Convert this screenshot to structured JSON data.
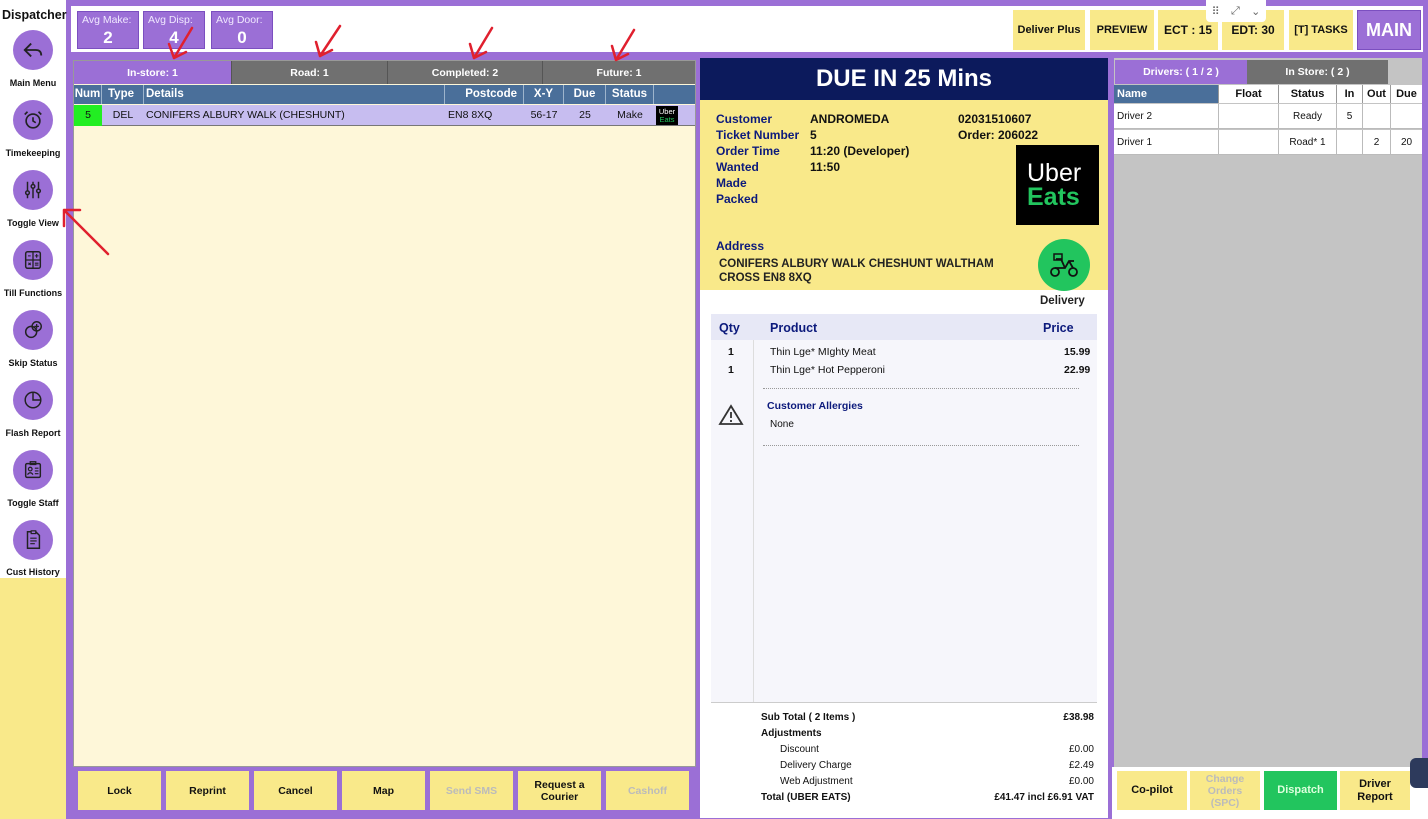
{
  "sidebar": {
    "title": "Dispatcher",
    "items": [
      {
        "label": "Main Menu",
        "icon": "back-arrow-icon"
      },
      {
        "label": "Timekeeping",
        "icon": "alarm-clock-icon"
      },
      {
        "label": "Toggle View",
        "icon": "sliders-icon"
      },
      {
        "label": "Till Functions",
        "icon": "calculator-icon"
      },
      {
        "label": "Skip Status",
        "icon": "skip-icon"
      },
      {
        "label": "Flash Report",
        "icon": "pie-chart-icon"
      },
      {
        "label": "Toggle Staff",
        "icon": "staff-card-icon"
      },
      {
        "label": "Cust History",
        "icon": "document-icon"
      }
    ]
  },
  "topbar": {
    "avg_make_label": "Avg Make:",
    "avg_make_value": "2",
    "avg_disp_label": "Avg Disp:",
    "avg_disp_value": "4",
    "avg_door_label": "Avg Door:",
    "avg_door_value": "0",
    "deliver_plus": "Deliver Plus",
    "preview": "PREVIEW",
    "ect": "ECT : 15",
    "edt": "EDT: 30",
    "tasks": "[T] TASKS",
    "main": "MAIN"
  },
  "order_tabs": [
    "In-store: 1",
    "Road: 1",
    "Completed: 2",
    "Future: 1"
  ],
  "order_columns": {
    "num": "Num",
    "type": "Type",
    "details": "Details",
    "postcode": "Postcode",
    "xy": "X-Y",
    "due": "Due",
    "status": "Status"
  },
  "orders": [
    {
      "num": "5",
      "type": "DEL",
      "details": "CONIFERS  ALBURY WALK (CHESHUNT)",
      "postcode": "EN8 8XQ",
      "xy": "56-17",
      "due": "25",
      "status": "Make",
      "source_top": "Uber",
      "source_bottom": "Eats"
    }
  ],
  "bottom_buttons": {
    "lock": "Lock",
    "reprint": "Reprint",
    "cancel": "Cancel",
    "map": "Map",
    "send_sms": "Send SMS",
    "courier_1": "Request a",
    "courier_2": "Courier",
    "cashoff": "Cashoff"
  },
  "ticket": {
    "due_banner": "DUE IN 25 Mins",
    "customer_label": "Customer",
    "customer": "ANDROMEDA",
    "phone": "02031510607",
    "ticket_label": "Ticket Number",
    "ticket_number": "5",
    "order_no": "Order:  206022",
    "order_time_label": "Order Time",
    "order_time": "11:20 (Developer)",
    "wanted_label": "Wanted",
    "wanted": "11:50",
    "made_label": "Made",
    "packed_label": "Packed",
    "logo_top": "Uber",
    "logo_bottom": "Eats",
    "address_label": "Address",
    "address_line1": "CONIFERS  ALBURY WALK CHESHUNT WALTHAM",
    "address_line2": "CROSS EN8 8XQ",
    "delivery_label": "Delivery",
    "qty_header": "Qty",
    "product_header": "Product",
    "price_header": "Price",
    "items": [
      {
        "qty": "1",
        "name": "Thin Lge* MIghty Meat",
        "price": "15.99"
      },
      {
        "qty": "1",
        "name": "Thin Lge* Hot Pepperoni",
        "price": "22.99"
      }
    ],
    "allergies_label": "Customer Allergies",
    "allergies_value": "None",
    "subtotal_label": "Sub Total  ( 2 Items )",
    "subtotal": "£38.98",
    "adjustments_label": "Adjustments",
    "discount_label": "Discount",
    "discount": "£0.00",
    "delivery_charge_label": "Delivery Charge",
    "delivery_charge": "£2.49",
    "web_adj_label": "Web Adjustment",
    "web_adj": "£0.00",
    "total_label": "Total (UBER EATS)",
    "total": "£41.47 incl £6.91 VAT"
  },
  "drivers": {
    "tab_drivers": "Drivers: ( 1 / 2 )",
    "tab_instore": "In Store: ( 2 )",
    "columns": {
      "name": "Name",
      "float": "Float",
      "status": "Status",
      "in": "In",
      "out": "Out",
      "due": "Due"
    },
    "rows": [
      {
        "name": "Driver 2",
        "float": "",
        "status": "Ready",
        "in": "5",
        "out": "",
        "due": ""
      },
      {
        "name": "Driver 1",
        "float": "",
        "status": "Road* 1",
        "in": "",
        "out": "2",
        "due": "20"
      }
    ],
    "copilot": "Co-pilot",
    "change_1": "Change",
    "change_2": "Orders",
    "change_3": "(SPC)",
    "dispatch": "Dispatch",
    "driver_report_1": "Driver",
    "driver_report_2": "Report"
  },
  "colors": {
    "accent": "#9b6fd6",
    "yellow": "#f9e98a",
    "navy": "#0c1a5c",
    "table_header": "#4a6f9a",
    "dispatch_green": "#22c55e"
  }
}
